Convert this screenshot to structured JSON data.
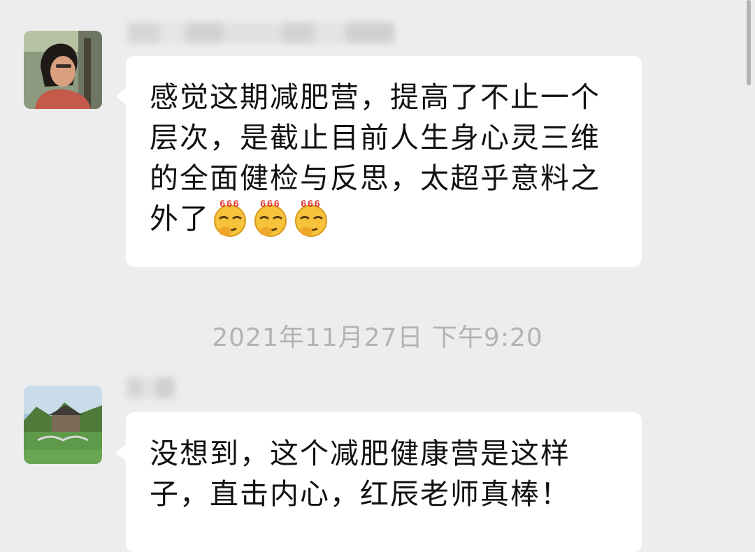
{
  "colors": {
    "background": "#ededed",
    "bubble": "#ffffff",
    "text": "#111111",
    "timestamp": "#b3b3b3"
  },
  "messages": [
    {
      "avatar_icon": "avatar-woman-photo",
      "text": "感觉这期减肥营，提高了不止一个层次，是截止目前人生身心灵三维的全面健检与反思，太超乎意料之外了",
      "emoji_icon": "666-emoji",
      "emoji_count": 3
    },
    {
      "avatar_icon": "avatar-landscape-photo",
      "text": "没想到，这个减肥健康营是这样子，直击内心，红辰老师真棒！"
    }
  ],
  "timestamp": "2021年11月27日 下午9:20"
}
